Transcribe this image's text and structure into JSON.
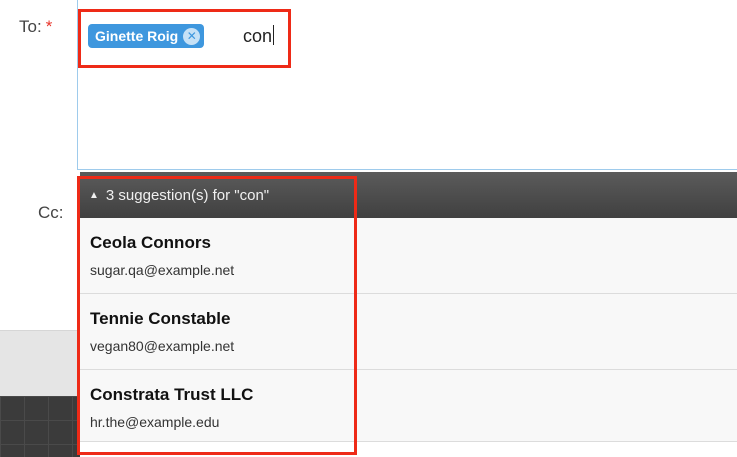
{
  "to_field": {
    "label": "To:",
    "required_marker": "*",
    "recipient_tag": {
      "name": "Ginette Roig",
      "remove_icon": "x-circle-icon"
    },
    "typed_text": "con"
  },
  "cc_field": {
    "label": "Cc:"
  },
  "suggestions": {
    "header": "3 suggestion(s) for \"con\"",
    "items": [
      {
        "name": "Ceola Connors",
        "email": "sugar.qa@example.net"
      },
      {
        "name": "Tennie Constable",
        "email": "vegan80@example.net"
      },
      {
        "name": "Constrata Trust LLC",
        "email": "hr.the@example.edu"
      }
    ]
  },
  "colors": {
    "tag": "#3e97de",
    "highlight": "#ee2a17",
    "required": "#e8352b"
  }
}
